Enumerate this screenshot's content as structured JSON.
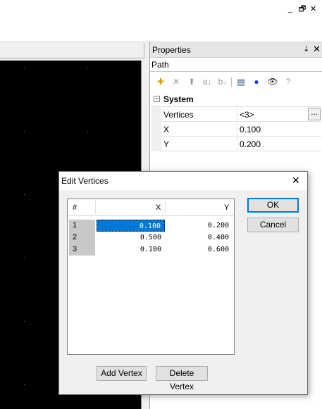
{
  "window": {
    "min_glyph": "_",
    "restore_glyph": "🗗",
    "close_glyph": "✕"
  },
  "properties": {
    "title": "Properties",
    "pin_glyph": "⇣",
    "close_glyph": "✕",
    "object_name": "Path",
    "toolbar": [
      {
        "name": "new-item-icon",
        "glyph": "✚",
        "active": true
      },
      {
        "name": "delete-icon",
        "glyph": "✕",
        "active": false
      },
      {
        "name": "move-up-icon",
        "glyph": "⬆",
        "active": false
      },
      {
        "name": "sort-az-icon",
        "glyph": "a↓",
        "active": false
      },
      {
        "name": "sort-za-icon",
        "glyph": "b↓",
        "active": false
      },
      {
        "name": "categorized-icon",
        "glyph": "▤",
        "active": true
      },
      {
        "name": "events-icon",
        "glyph": "●",
        "active": true
      },
      {
        "name": "view-icon",
        "glyph": "👁",
        "active": true
      },
      {
        "name": "help-icon",
        "glyph": "?",
        "active": false
      }
    ],
    "category": {
      "expander": "−",
      "label": "System"
    },
    "rows": [
      {
        "name": "Vertices",
        "value": "<3>",
        "has_button": true,
        "button_label": "..."
      },
      {
        "name": "X",
        "value": "0.100"
      },
      {
        "name": "Y",
        "value": "0.200"
      }
    ]
  },
  "dialog": {
    "title": "Edit Vertices",
    "close_glyph": "✕",
    "columns": {
      "num": "#",
      "x": "X",
      "y": "Y"
    },
    "vertices": [
      {
        "num": "1",
        "x": "0.100",
        "y": "0.200"
      },
      {
        "num": "2",
        "x": "0.500",
        "y": "0.400"
      },
      {
        "num": "3",
        "x": "0.100",
        "y": "0.600"
      }
    ],
    "ok_label": "OK",
    "cancel_label": "Cancel",
    "add_label": "Add Vertex",
    "delete_label": "Delete Vertex"
  },
  "colors": {
    "selection": "#0078d7",
    "canvas": "#000000"
  }
}
